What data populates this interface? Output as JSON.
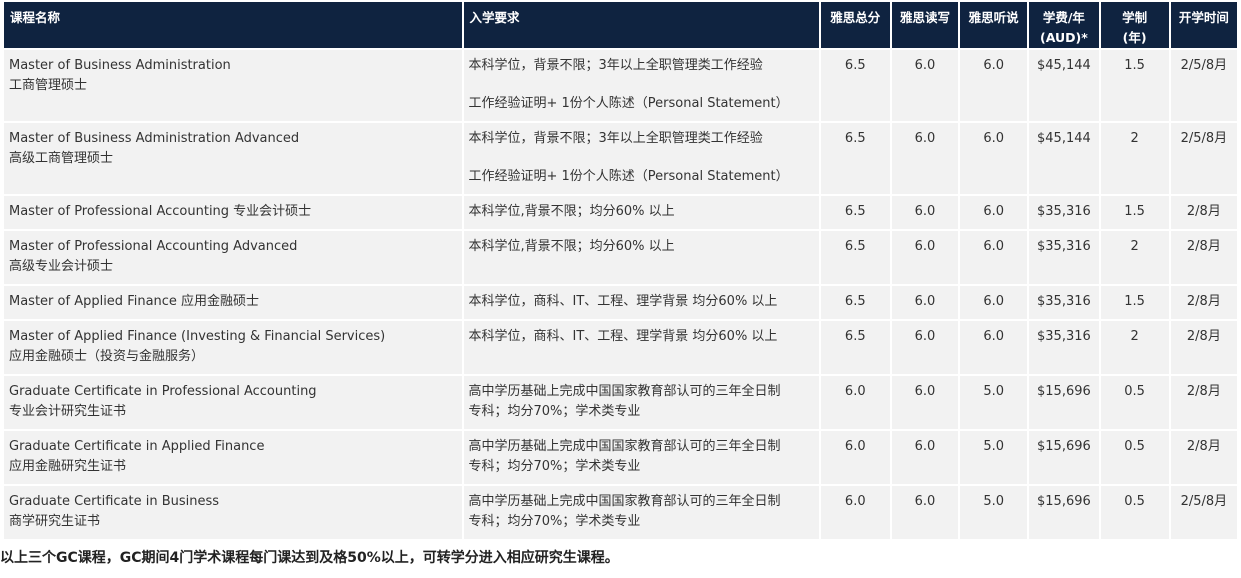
{
  "headers": [
    "课程名称",
    "入学要求",
    "雅思总分",
    "雅思读写",
    "雅思听说",
    "学费/年 (AUD)*",
    "学制 (年)",
    "开学时间"
  ],
  "header_lines": [
    [
      "课程名称"
    ],
    [
      "入学要求"
    ],
    [
      "雅思总分"
    ],
    [
      "雅思读写"
    ],
    [
      "雅思听说"
    ],
    [
      "学费/年",
      "(AUD)*"
    ],
    [
      "学制",
      "(年)"
    ],
    [
      "开学时间"
    ]
  ],
  "rows": [
    {
      "name": [
        "Master of Business Administration",
        "工商管理硕士"
      ],
      "req": [
        "本科学位，背景不限；3年以上全职管理类工作经验",
        "",
        "工作经验证明+ 1份个人陈述（Personal Statement）"
      ],
      "ielts": "6.5",
      "rw": "6.0",
      "ls": "6.0",
      "fee": "$45,144",
      "years": "1.5",
      "intake": "2/5/8月"
    },
    {
      "name": [
        "Master of Business Administration Advanced",
        "高级工商管理硕士"
      ],
      "req": [
        "本科学位，背景不限；3年以上全职管理类工作经验",
        "",
        "工作经验证明+ 1份个人陈述（Personal Statement）"
      ],
      "ielts": "6.5",
      "rw": "6.0",
      "ls": "6.0",
      "fee": "$45,144",
      "years": "2",
      "intake": "2/5/8月"
    },
    {
      "name": [
        "Master of Professional Accounting 专业会计硕士"
      ],
      "req": [
        "本科学位,背景不限；均分60% 以上"
      ],
      "ielts": "6.5",
      "rw": "6.0",
      "ls": "6.0",
      "fee": "$35,316",
      "years": "1.5",
      "intake": "2/8月"
    },
    {
      "name": [
        "Master of Professional Accounting Advanced",
        "高级专业会计硕士"
      ],
      "req": [
        "本科学位,背景不限；均分60% 以上"
      ],
      "ielts": "6.5",
      "rw": "6.0",
      "ls": "6.0",
      "fee": "$35,316",
      "years": "2",
      "intake": "2/8月"
    },
    {
      "name": [
        "Master of Applied Finance 应用金融硕士"
      ],
      "req": [
        "本科学位，商科、IT、工程、理学背景 均分60% 以上"
      ],
      "ielts": "6.5",
      "rw": "6.0",
      "ls": "6.0",
      "fee": "$35,316",
      "years": "1.5",
      "intake": "2/8月"
    },
    {
      "name": [
        "Master of Applied Finance (Investing & Financial Services)",
        "应用金融硕士（投资与金融服务）"
      ],
      "req": [
        "本科学位，商科、IT、工程、理学背景 均分60% 以上"
      ],
      "ielts": "6.5",
      "rw": "6.0",
      "ls": "6.0",
      "fee": "$35,316",
      "years": "2",
      "intake": "2/8月"
    },
    {
      "name": [
        "Graduate Certificate in Professional Accounting",
        "专业会计研究生证书"
      ],
      "req": [
        "高中学历基础上完成中国国家教育部认可的三年全日制",
        "专科；均分70%；学术类专业"
      ],
      "ielts": "6.0",
      "rw": "6.0",
      "ls": "5.0",
      "fee": "$15,696",
      "years": "0.5",
      "intake": "2/8月"
    },
    {
      "name": [
        "Graduate Certificate in Applied Finance",
        "应用金融研究生证书"
      ],
      "req": [
        "高中学历基础上完成中国国家教育部认可的三年全日制",
        "专科；均分70%；学术类专业"
      ],
      "ielts": "6.0",
      "rw": "6.0",
      "ls": "5.0",
      "fee": "$15,696",
      "years": "0.5",
      "intake": "2/8月"
    },
    {
      "name": [
        "Graduate Certificate in Business",
        "商学研究生证书"
      ],
      "req": [
        "高中学历基础上完成中国国家教育部认可的三年全日制",
        "专科；均分70%；学术类专业"
      ],
      "ielts": "6.0",
      "rw": "6.0",
      "ls": "5.0",
      "fee": "$15,696",
      "years": "0.5",
      "intake": "2/5/8月"
    }
  ],
  "footnote": "以上三个GC课程，GC期间4门学术课程每门课达到及格50%以上，可转学分进入相应研究生课程。"
}
